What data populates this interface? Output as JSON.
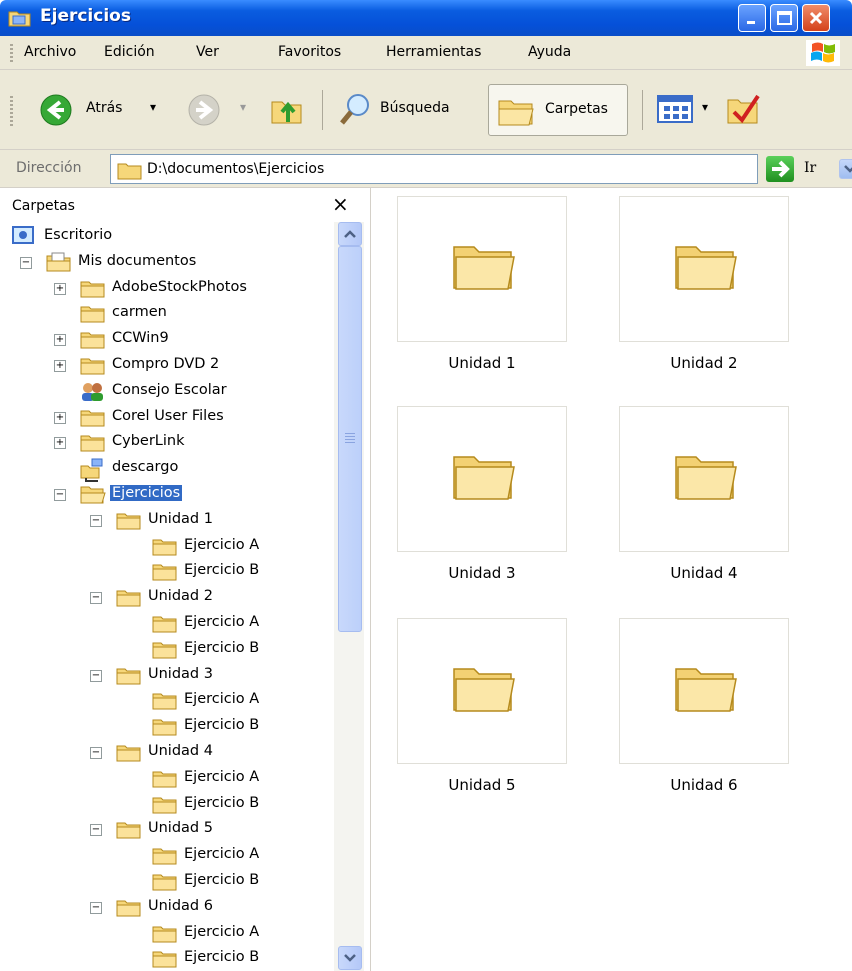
{
  "window": {
    "title": "Ejercicios"
  },
  "menu": [
    "Archivo",
    "Edición",
    "Ver",
    "Favoritos",
    "Herramientas",
    "Ayuda"
  ],
  "toolbar": {
    "back_label": "Atrás",
    "search_label": "Búsqueda",
    "folders_label": "Carpetas"
  },
  "address": {
    "label": "Dirección",
    "value": "D:\\documentos\\Ejercicios",
    "go_label": "Ir"
  },
  "folder_pane": {
    "title": "Carpetas",
    "close_glyph": "×",
    "tree": [
      {
        "label": "Escritorio",
        "icon": "desktop-icon",
        "level": 0,
        "expander": ""
      },
      {
        "label": "Mis documentos",
        "icon": "my-documents-icon",
        "level": 1,
        "expander": "minus"
      },
      {
        "label": "AdobeStockPhotos",
        "icon": "folder-icon",
        "level": 2,
        "expander": "plus"
      },
      {
        "label": "carmen",
        "icon": "folder-icon",
        "level": 2,
        "expander": ""
      },
      {
        "label": "CCWin9",
        "icon": "folder-icon",
        "level": 2,
        "expander": "plus"
      },
      {
        "label": "Compro DVD 2",
        "icon": "folder-icon",
        "level": 2,
        "expander": "plus"
      },
      {
        "label": "Consejo Escolar",
        "icon": "users-icon",
        "level": 2,
        "expander": ""
      },
      {
        "label": "Corel User Files",
        "icon": "folder-icon",
        "level": 2,
        "expander": "plus"
      },
      {
        "label": "CyberLink",
        "icon": "folder-icon",
        "level": 2,
        "expander": "plus"
      },
      {
        "label": "descargo",
        "icon": "network-folder-icon",
        "level": 2,
        "expander": ""
      },
      {
        "label": "Ejercicios",
        "icon": "folder-open-icon",
        "level": 2,
        "expander": "minus",
        "selected": true
      },
      {
        "label": "Unidad 1",
        "icon": "folder-icon",
        "level": 3,
        "expander": "minus"
      },
      {
        "label": "Ejercicio A",
        "icon": "folder-icon",
        "level": 4,
        "expander": ""
      },
      {
        "label": "Ejercicio B",
        "icon": "folder-icon",
        "level": 4,
        "expander": ""
      },
      {
        "label": "Unidad 2",
        "icon": "folder-icon",
        "level": 3,
        "expander": "minus"
      },
      {
        "label": "Ejercicio A",
        "icon": "folder-icon",
        "level": 4,
        "expander": ""
      },
      {
        "label": "Ejercicio B",
        "icon": "folder-icon",
        "level": 4,
        "expander": ""
      },
      {
        "label": "Unidad 3",
        "icon": "folder-icon",
        "level": 3,
        "expander": "minus"
      },
      {
        "label": "Ejercicio A",
        "icon": "folder-icon",
        "level": 4,
        "expander": ""
      },
      {
        "label": "Ejercicio B",
        "icon": "folder-icon",
        "level": 4,
        "expander": ""
      },
      {
        "label": "Unidad 4",
        "icon": "folder-icon",
        "level": 3,
        "expander": "minus"
      },
      {
        "label": "Ejercicio A",
        "icon": "folder-icon",
        "level": 4,
        "expander": ""
      },
      {
        "label": "Ejercicio B",
        "icon": "folder-icon",
        "level": 4,
        "expander": ""
      },
      {
        "label": "Unidad 5",
        "icon": "folder-icon",
        "level": 3,
        "expander": "minus"
      },
      {
        "label": "Ejercicio A",
        "icon": "folder-icon",
        "level": 4,
        "expander": ""
      },
      {
        "label": "Ejercicio B",
        "icon": "folder-icon",
        "level": 4,
        "expander": ""
      },
      {
        "label": "Unidad 6",
        "icon": "folder-icon",
        "level": 3,
        "expander": "minus"
      },
      {
        "label": "Ejercicio A",
        "icon": "folder-icon",
        "level": 4,
        "expander": ""
      },
      {
        "label": "Ejercicio B",
        "icon": "folder-icon",
        "level": 4,
        "expander": ""
      }
    ]
  },
  "items": [
    {
      "label": "Unidad 1"
    },
    {
      "label": "Unidad 2"
    },
    {
      "label": "Unidad 3"
    },
    {
      "label": "Unidad 4"
    },
    {
      "label": "Unidad 5"
    },
    {
      "label": "Unidad 6"
    }
  ],
  "colors": {
    "titlebar": "#0a5de0",
    "chrome": "#ece9d8",
    "selection": "#316ac5",
    "folder": "#f6d77a"
  }
}
